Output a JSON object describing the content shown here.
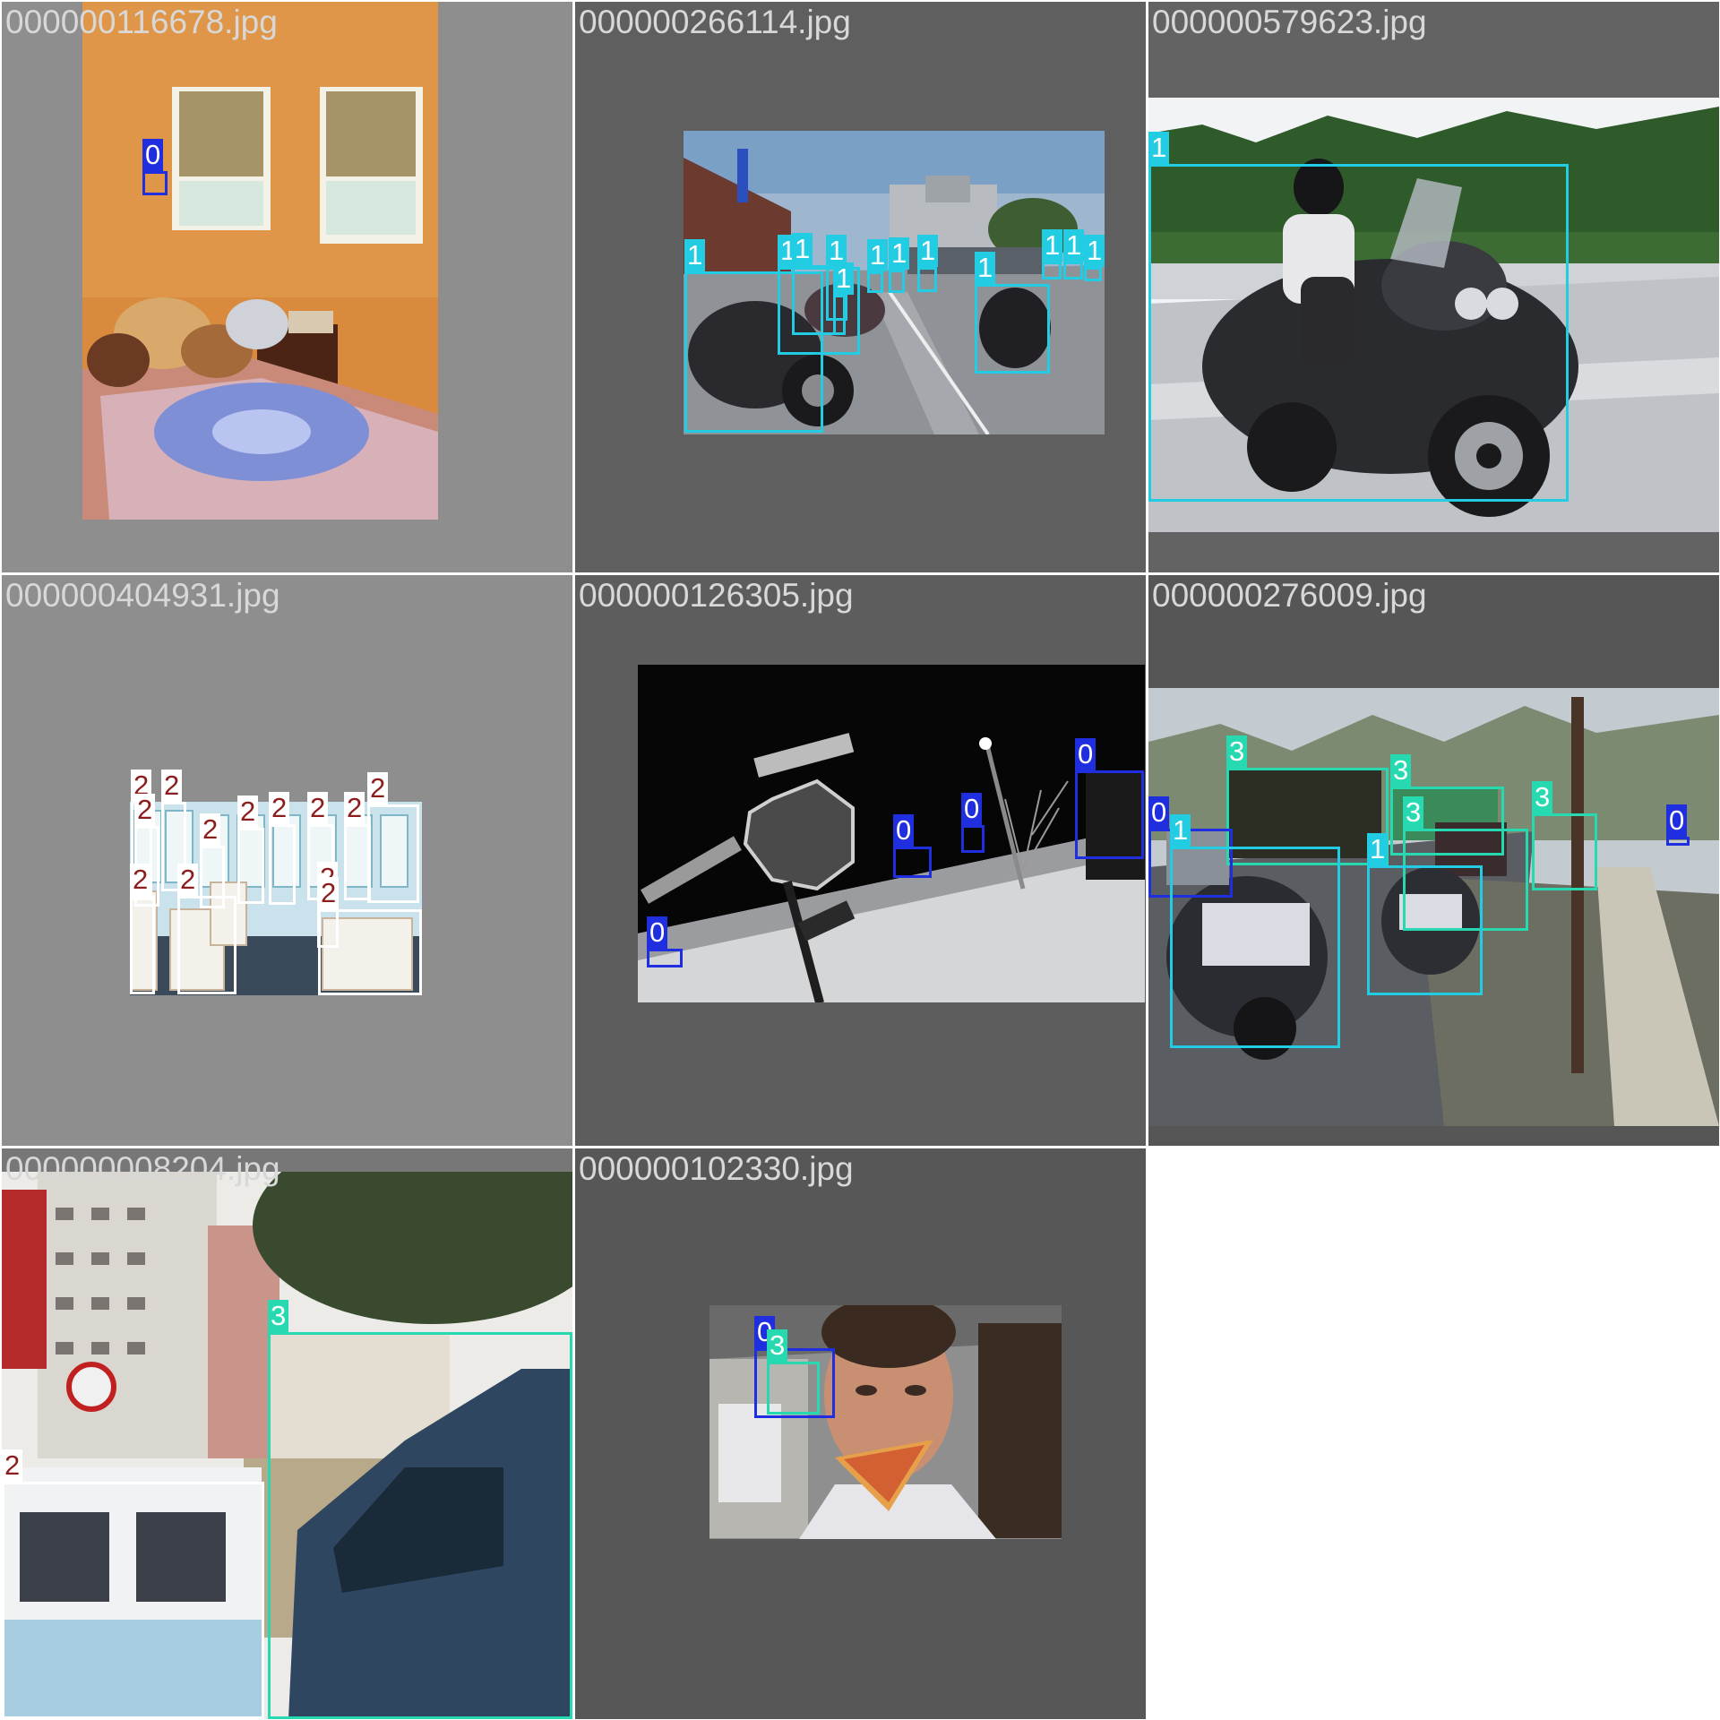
{
  "palette": {
    "class_0": "#1f2ede",
    "class_1": "#22cde3",
    "class_2": "#8c1d1d",
    "class_2_label_bg": "#ffffff",
    "class_3": "#27d9b0"
  },
  "tiles": [
    {
      "filename": "000000116678.jpg",
      "boxes": [
        {
          "label": "0"
        }
      ]
    },
    {
      "filename": "000000266114.jpg",
      "boxes": [
        {
          "label": "1"
        },
        {
          "label": "1"
        },
        {
          "label": "1"
        },
        {
          "label": "1"
        },
        {
          "label": "1"
        },
        {
          "label": "1"
        },
        {
          "label": "1"
        },
        {
          "label": "1"
        },
        {
          "label": "1"
        },
        {
          "label": "1"
        },
        {
          "label": "1"
        },
        {
          "label": "1"
        }
      ]
    },
    {
      "filename": "000000579623.jpg",
      "boxes": [
        {
          "label": "1"
        }
      ]
    },
    {
      "filename": "000000404931.jpg",
      "boxes": [
        {
          "label": "2"
        },
        {
          "label": "2"
        },
        {
          "label": "2"
        },
        {
          "label": "2"
        },
        {
          "label": "2"
        },
        {
          "label": "2"
        },
        {
          "label": "2"
        },
        {
          "label": "2"
        },
        {
          "label": "2"
        },
        {
          "label": "2"
        },
        {
          "label": "2"
        },
        {
          "label": "2"
        },
        {
          "label": "2"
        }
      ]
    },
    {
      "filename": "000000126305.jpg",
      "boxes": [
        {
          "label": "0"
        },
        {
          "label": "0"
        },
        {
          "label": "0"
        },
        {
          "label": "0"
        }
      ]
    },
    {
      "filename": "000000276009.jpg",
      "boxes": [
        {
          "label": "3"
        },
        {
          "label": "3"
        },
        {
          "label": "3"
        },
        {
          "label": "3"
        },
        {
          "label": "0"
        },
        {
          "label": "1"
        },
        {
          "label": "1"
        },
        {
          "label": "0"
        }
      ]
    },
    {
      "filename": "000000008204.jpg",
      "boxes": [
        {
          "label": "3"
        },
        {
          "label": "2"
        }
      ]
    },
    {
      "filename": "000000102330.jpg",
      "boxes": [
        {
          "label": "0"
        },
        {
          "label": "3"
        }
      ]
    }
  ]
}
